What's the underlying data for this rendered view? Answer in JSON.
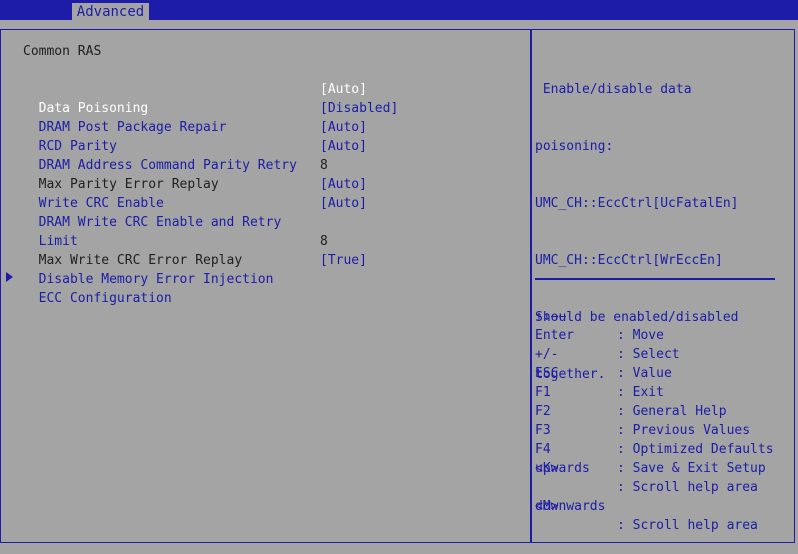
{
  "header": {
    "active_tab": "Advanced"
  },
  "main": {
    "section_title": "Common RAS",
    "settings": [
      {
        "label": "Data Poisoning",
        "value": "[Auto]"
      },
      {
        "label": "DRAM Post Package Repair",
        "value": "[Disabled]"
      },
      {
        "label": "RCD Parity",
        "value": "[Auto]"
      },
      {
        "label": "DRAM Address Command Parity Retry",
        "value": "[Auto]"
      },
      {
        "label": "Max Parity Error Replay",
        "value": "8"
      },
      {
        "label": "Write CRC Enable",
        "value": "[Auto]"
      },
      {
        "label": "DRAM Write CRC Enable and Retry",
        "label_cont": "Limit",
        "value": "[Auto]"
      },
      {
        "label": "Max Write CRC Error Replay",
        "value": "8"
      },
      {
        "label": "Disable Memory Error Injection",
        "value": "[True]"
      }
    ],
    "submenu": {
      "label": "ECC Configuration"
    }
  },
  "help": {
    "lines": [
      " Enable/disable data",
      "poisoning:",
      "UMC_CH::EccCtrl[UcFatalEn]",
      "UMC_CH::EccCtrl[WrEccEn]",
      "Should be enabled/disabled",
      "together."
    ]
  },
  "keys": [
    {
      "key": "↑↓→←",
      "desc": ": Move"
    },
    {
      "key": "Enter",
      "desc": ": Select"
    },
    {
      "key": "+/-",
      "desc": ": Value"
    },
    {
      "key": "ESC",
      "desc": ": Exit"
    },
    {
      "key": "F1",
      "desc": ": General Help"
    },
    {
      "key": "F2",
      "desc": ": Previous Values"
    },
    {
      "key": "F3",
      "desc": ": Optimized Defaults"
    },
    {
      "key": "F4",
      "desc": ": Save & Exit Setup"
    },
    {
      "key": "<K>",
      "desc": ": Scroll help area",
      "cont": "upwards"
    },
    {
      "key": "<M>",
      "desc": ": Scroll help area",
      "cont": "downwards"
    }
  ],
  "colors": {
    "background": "#a4a4a4",
    "accent": "#1c1ca8",
    "highlight": "#ffffff"
  }
}
